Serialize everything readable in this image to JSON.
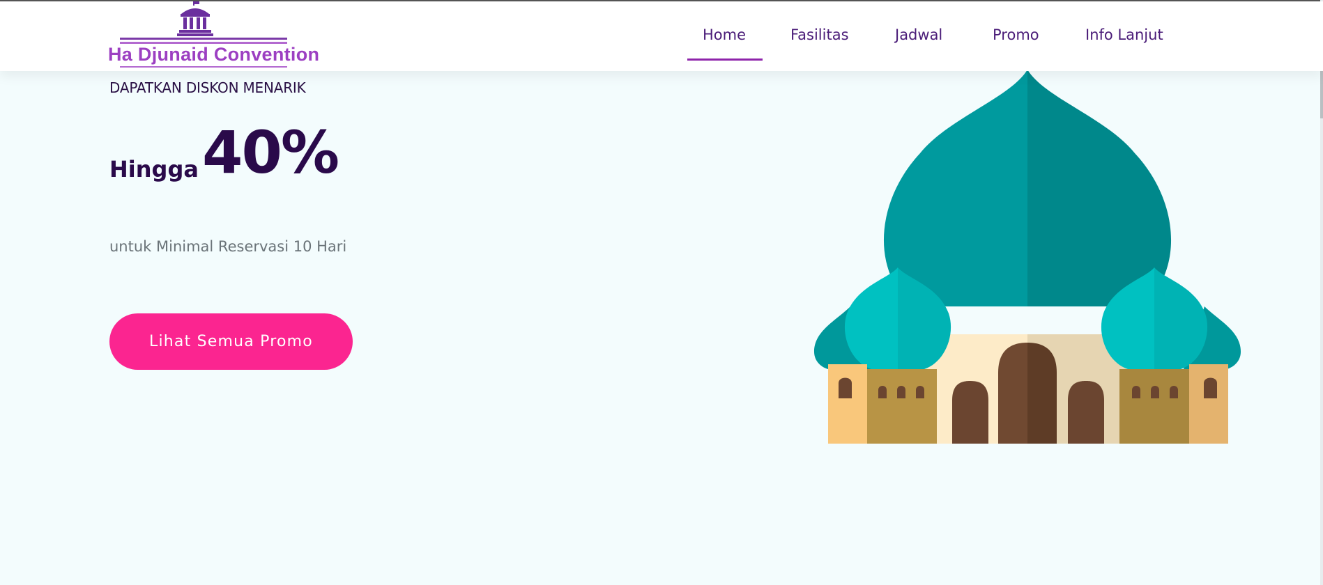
{
  "brand": {
    "name": "Ha Djunaid Convention"
  },
  "nav": {
    "items": [
      {
        "label": "Home",
        "active": true
      },
      {
        "label": "Fasilitas"
      },
      {
        "label": "Jadwal"
      },
      {
        "label": "Promo"
      },
      {
        "label": "Info Lanjut"
      }
    ]
  },
  "hero": {
    "eyebrow": "DAPATKAN DISKON MENARIK",
    "prefix": "Hingga",
    "discount": "40%",
    "subtext": "untuk Minimal Reservasi 10 Hari",
    "cta_label": "Lihat Semua Promo"
  },
  "colors": {
    "accent": "#fb2590",
    "nav_text": "#4a1c78",
    "active_underline": "#8e24aa",
    "background": "#f3fcfd"
  },
  "icons": [
    "building-columns-icon",
    "mosque-illustration"
  ]
}
